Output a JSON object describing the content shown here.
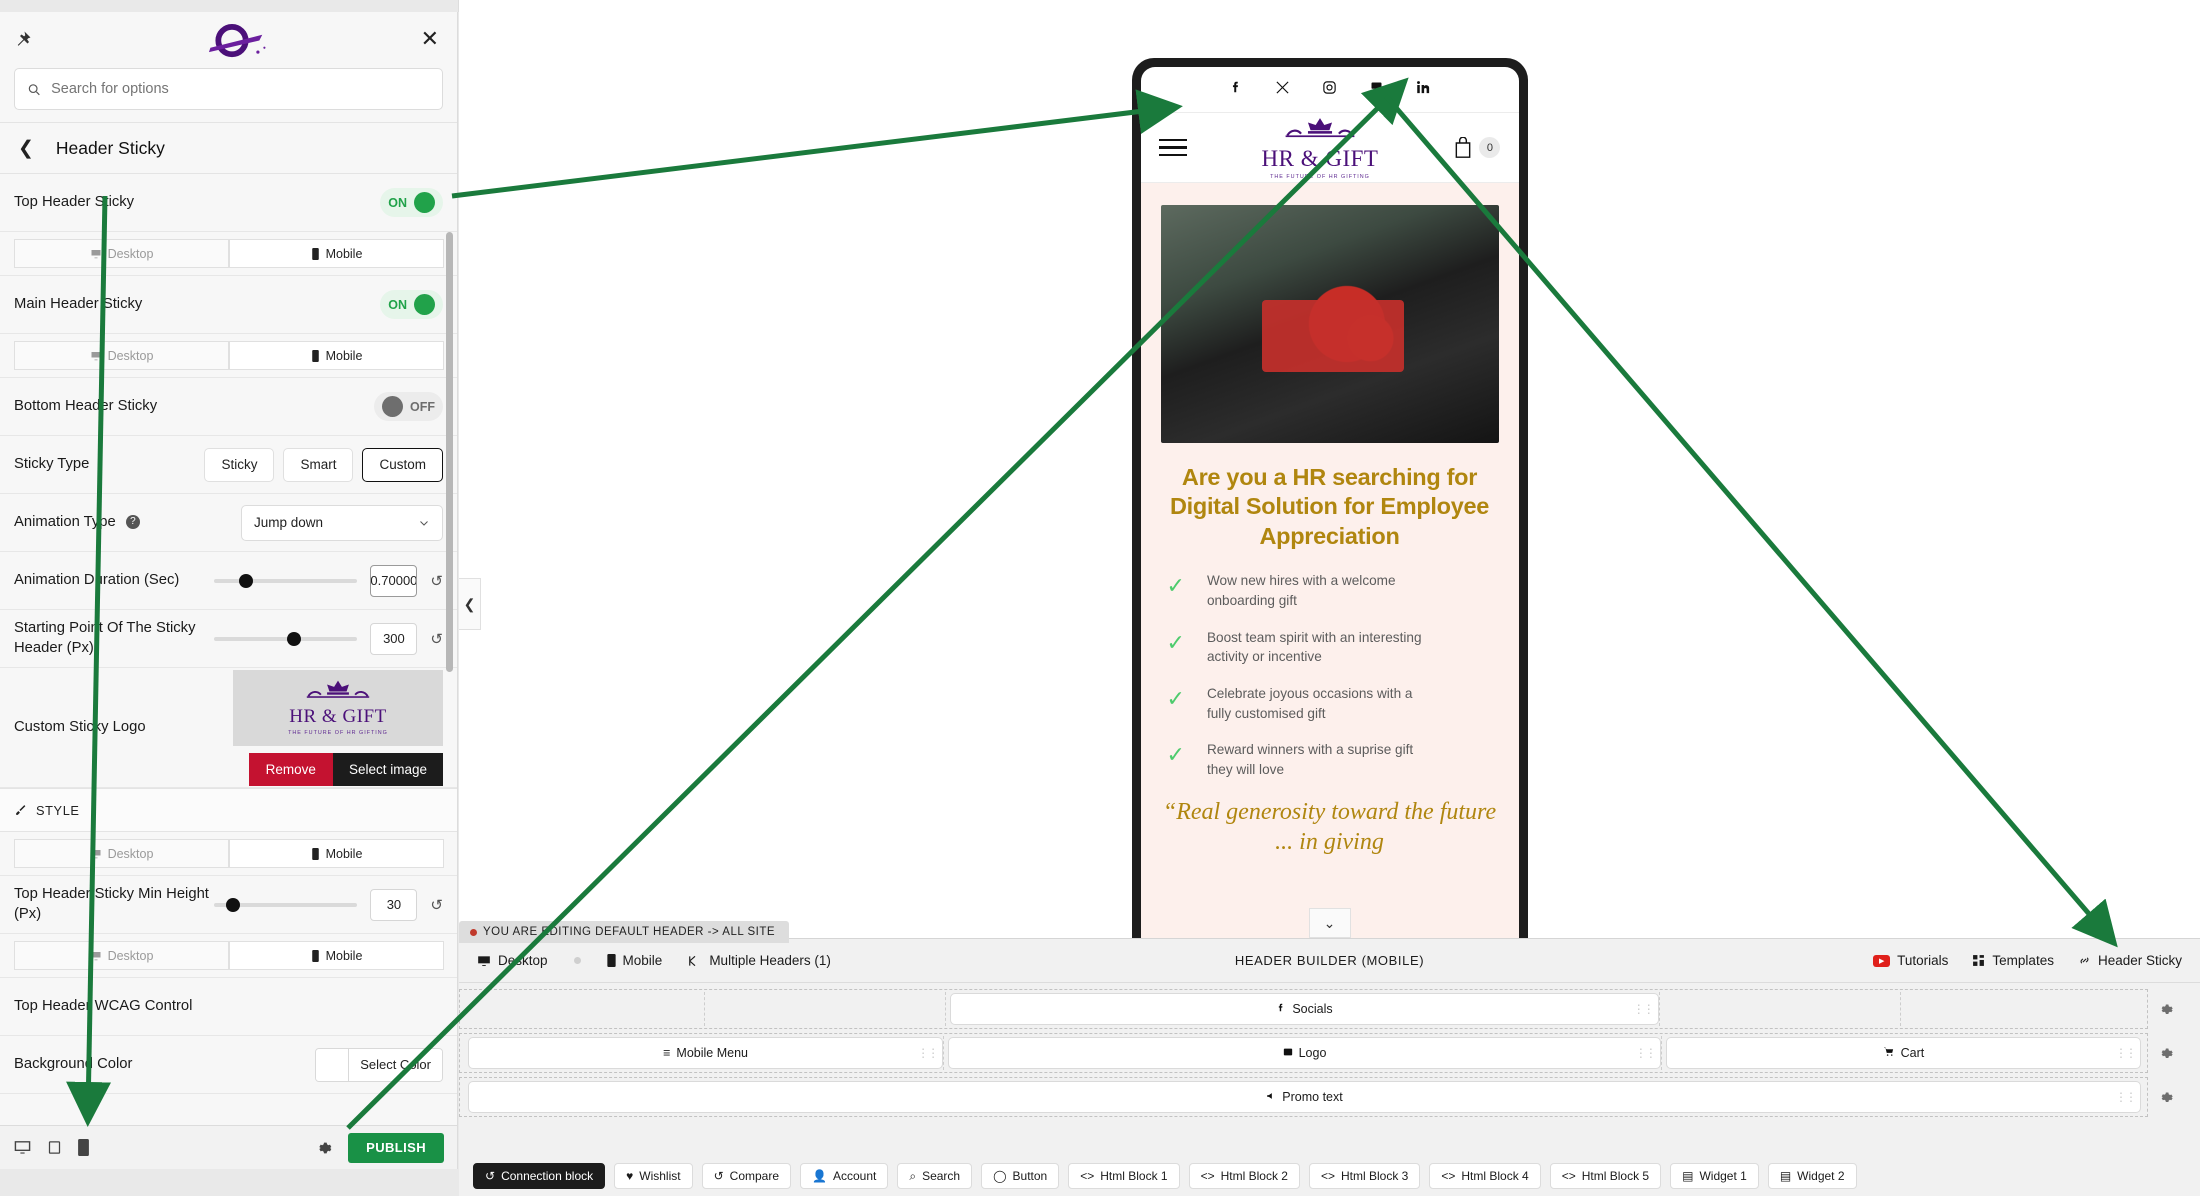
{
  "sidebar": {
    "search_placeholder": "Search for options",
    "panel_title": "Header Sticky",
    "back_icon": "chevron-left-icon",
    "pin_icon": "pin-icon",
    "close_icon": "close-icon",
    "device_desktop": "Desktop",
    "device_mobile": "Mobile",
    "rows": {
      "top_header_sticky": {
        "label": "Top Header Sticky",
        "state": "ON"
      },
      "main_header_sticky": {
        "label": "Main Header Sticky",
        "state": "ON"
      },
      "bottom_header_sticky": {
        "label": "Bottom Header Sticky",
        "state": "OFF"
      },
      "sticky_type": {
        "label": "Sticky Type",
        "options": [
          "Sticky",
          "Smart",
          "Custom"
        ],
        "selected": "Custom"
      },
      "animation_type": {
        "label": "Animation Type",
        "value": "Jump down"
      },
      "animation_duration": {
        "label": "Animation Duration (Sec)",
        "value": "0.70000"
      },
      "starting_point": {
        "label": "Starting Point Of The Sticky Header (Px)",
        "value": "300"
      },
      "custom_sticky_logo": {
        "label": "Custom Sticky Logo",
        "remove_label": "Remove",
        "select_label": "Select image"
      },
      "style_section": "STYLE",
      "min_height": {
        "label": "Top Header Sticky Min Height (Px)",
        "value": "30"
      },
      "wcag_control": {
        "label": "Top Header WCAG Control"
      },
      "background_color": {
        "label": "Background Color",
        "button": "Select Color"
      }
    },
    "footer": {
      "publish_label": "PUBLISH",
      "gear_icon": "gear-icon"
    }
  },
  "preview": {
    "logo_name": "HR & GIFT",
    "logo_tagline": "THE FUTURE OF HR GIFTING",
    "cart_count": "0",
    "socials": [
      "facebook-icon",
      "x-twitter-icon",
      "instagram-icon",
      "youtube-icon",
      "linkedin-icon"
    ],
    "hero_title": "Are you a HR searching for Digital Solution for Employee Appreciation",
    "features": [
      "Wow new hires with a welcome onboarding gift",
      "Boost team spirit with an interesting activity or incentive",
      "Celebrate joyous occasions with a fully customised gift",
      "Reward winners with a suprise gift they will love"
    ],
    "quote": "“Real generosity toward the future ... in giving"
  },
  "builder": {
    "editing_notice": "YOU ARE EDITING DEFAULT HEADER -> ALL SITE",
    "tabs": [
      {
        "label": "Desktop",
        "icon": "desktop-icon",
        "active": false
      },
      {
        "label": "Mobile",
        "icon": "mobile-icon",
        "active": true
      },
      {
        "label": "Multiple Headers (1)",
        "icon": "layers-icon",
        "active": false
      }
    ],
    "title": "HEADER BUILDER (MOBILE)",
    "actions": [
      {
        "label": "Tutorials",
        "icon": "youtube-icon"
      },
      {
        "label": "Templates",
        "icon": "templates-icon"
      },
      {
        "label": "Header Sticky",
        "icon": "link-icon"
      }
    ],
    "rows": [
      {
        "items": [
          {
            "label": "Socials",
            "icon": "facebook-icon"
          }
        ]
      },
      {
        "items": [
          {
            "label": "Mobile Menu",
            "icon": "menu-icon"
          },
          {
            "label": "Logo",
            "icon": "image-icon"
          },
          {
            "label": "Cart",
            "icon": "cart-icon"
          }
        ]
      },
      {
        "items": [
          {
            "label": "Promo text",
            "icon": "megaphone-icon"
          }
        ]
      }
    ],
    "blocks": [
      {
        "label": "Connection block",
        "icon": "connection-icon",
        "primary": true
      },
      {
        "label": "Wishlist",
        "icon": "heart-icon",
        "primary": false
      },
      {
        "label": "Compare",
        "icon": "compare-icon",
        "primary": false
      },
      {
        "label": "Account",
        "icon": "user-icon",
        "primary": false
      },
      {
        "label": "Search",
        "icon": "search-icon",
        "primary": false
      },
      {
        "label": "Button",
        "icon": "button-icon",
        "primary": false
      },
      {
        "label": "Html Block 1",
        "icon": "code-icon",
        "primary": false
      },
      {
        "label": "Html Block 2",
        "icon": "code-icon",
        "primary": false
      },
      {
        "label": "Html Block 3",
        "icon": "code-icon",
        "primary": false
      },
      {
        "label": "Html Block 4",
        "icon": "code-icon",
        "primary": false
      },
      {
        "label": "Html Block 5",
        "icon": "code-icon",
        "primary": false
      },
      {
        "label": "Widget 1",
        "icon": "widget-icon",
        "primary": false
      },
      {
        "label": "Widget 2",
        "icon": "widget-icon",
        "primary": false
      }
    ]
  },
  "colors": {
    "accent_green": "#199146",
    "toggle_on": "#21a24a",
    "toggle_off": "#6e6e6e",
    "remove_red": "#c41230",
    "brand_purple": "#4b1079",
    "hero_gold": "#b0860f",
    "annotation_green": "#1a7a3c"
  }
}
